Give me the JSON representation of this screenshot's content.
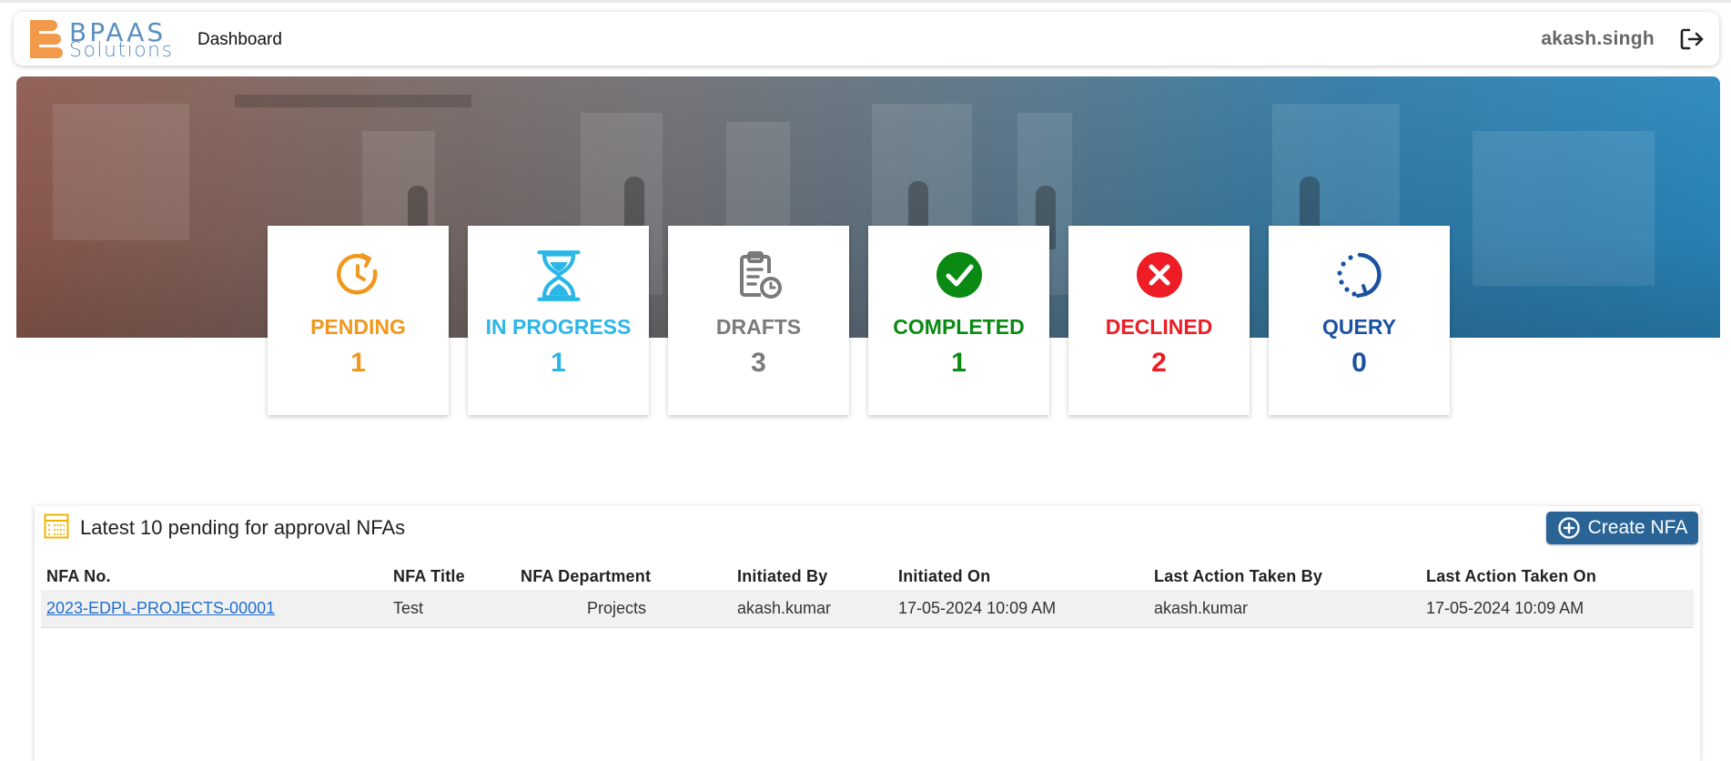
{
  "header": {
    "logo_top": "BPAAS",
    "logo_bottom": "Solutions",
    "nav_dashboard": "Dashboard",
    "user_name": "akash.singh"
  },
  "cards": [
    {
      "label": "PENDING",
      "count": "1",
      "color": "#f0981e",
      "icon": "clock-refresh-icon"
    },
    {
      "label": "IN PROGRESS",
      "count": "1",
      "color": "#2bb6e8",
      "icon": "hourglass-icon"
    },
    {
      "label": "DRAFTS",
      "count": "3",
      "color": "#7a7a7a",
      "icon": "clipboard-clock-icon"
    },
    {
      "label": "COMPLETED",
      "count": "1",
      "color": "#0a8a12",
      "icon": "check-circle-icon"
    },
    {
      "label": "DECLINED",
      "count": "2",
      "color": "#ee1c24",
      "icon": "x-circle-icon"
    },
    {
      "label": "QUERY",
      "count": "0",
      "color": "#1a52a0",
      "icon": "rotate-dotted-icon"
    }
  ],
  "panel": {
    "title": "Latest 10 pending for approval NFAs",
    "create_label": "Create NFA",
    "columns": [
      "NFA No.",
      "NFA Title",
      "NFA Department",
      "Initiated By",
      "Initiated On",
      "Last Action Taken By",
      "Last Action Taken On"
    ],
    "rows": [
      {
        "nfa_no": "2023-EDPL-PROJECTS-00001",
        "title": "Test",
        "department": "Projects",
        "initiated_by": "akash.kumar",
        "initiated_on": "17-05-2024 10:09 AM",
        "last_action_by": "akash.kumar",
        "last_action_on": "17-05-2024 10:09 AM"
      }
    ]
  }
}
